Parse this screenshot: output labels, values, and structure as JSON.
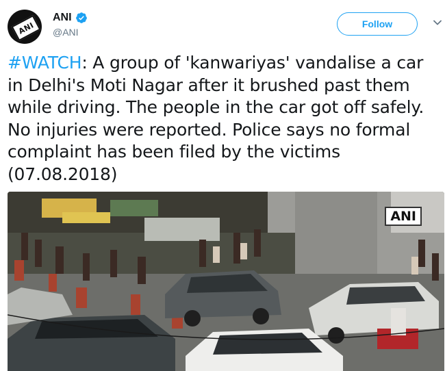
{
  "account": {
    "display_name": "ANI",
    "handle": "@ANI",
    "avatar_text": "ANI",
    "verified": true
  },
  "follow_button": {
    "label": "Follow"
  },
  "tweet": {
    "hashtag": "#WATCH",
    "body": ": A group of 'kanwariyas' vandalise a car in Delhi's Moti Nagar after it brushed past them while driving. The people in the car got off safely. No injuries were reported. Police says no formal complaint has been filed by the victims (07.08.2018)"
  },
  "media": {
    "watermark": "ANI"
  },
  "colors": {
    "accent": "#1da1f2",
    "text": "#14171a",
    "muted": "#657786"
  },
  "icons": {
    "verified": "verified-badge-icon",
    "menu": "chevron-down-icon"
  }
}
